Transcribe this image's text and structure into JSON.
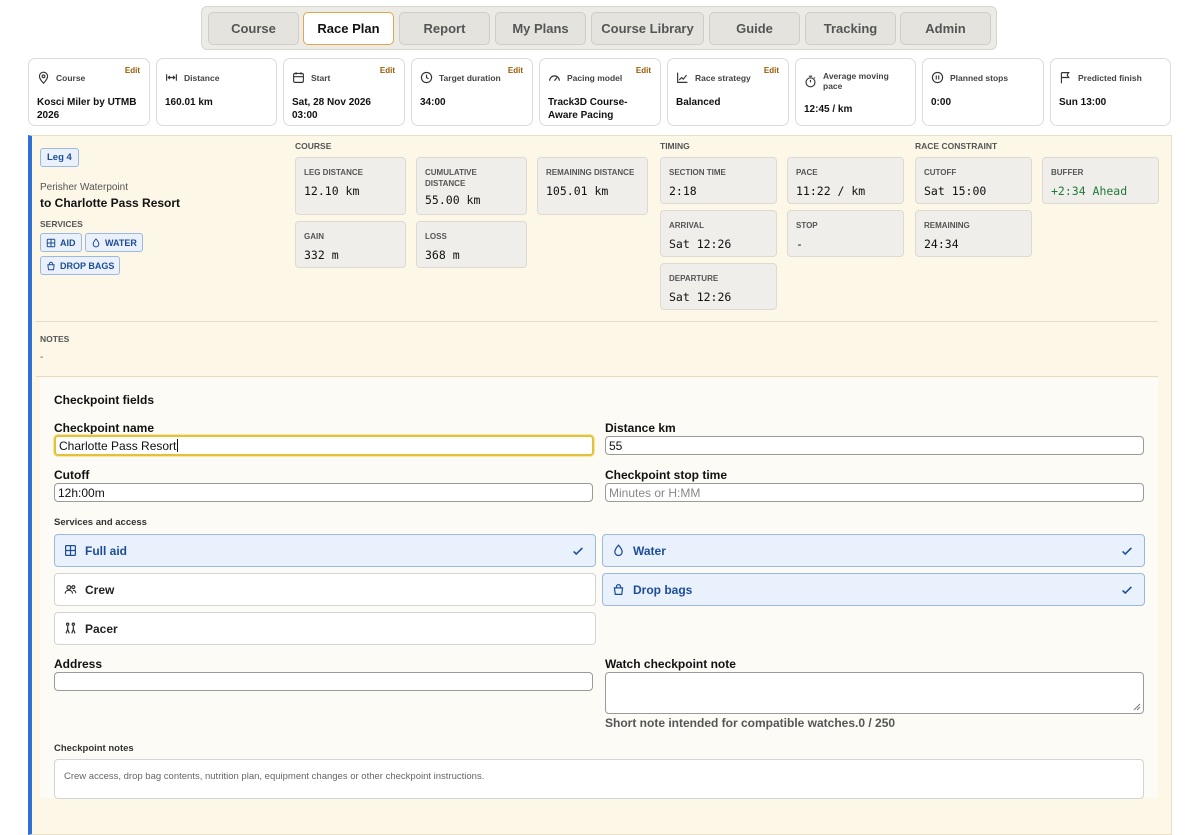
{
  "tabs": [
    "Course",
    "Race Plan",
    "Report",
    "My Plans",
    "Course Library",
    "Guide",
    "Tracking",
    "Admin"
  ],
  "active_tab": "Race Plan",
  "summary": {
    "edit_label": "Edit",
    "course": {
      "label": "Course",
      "value": "Kosci Miler by UTMB 2026"
    },
    "distance": {
      "label": "Distance",
      "value": "160.01 km"
    },
    "start": {
      "label": "Start",
      "value": "Sat, 28 Nov 2026 03:00"
    },
    "target_duration": {
      "label": "Target duration",
      "value": "34:00"
    },
    "pacing_model": {
      "label": "Pacing model",
      "value": "Track3D Course-Aware Pacing"
    },
    "race_strategy": {
      "label": "Race strategy",
      "value": "Balanced"
    },
    "avg_pace": {
      "label": "Average moving pace",
      "value": "12:45 / km"
    },
    "planned_stops": {
      "label": "Planned stops",
      "value": "0:00"
    },
    "predicted_finish": {
      "label": "Predicted finish",
      "value": "Sun 13:00"
    }
  },
  "leg": {
    "badge": "Leg 4",
    "from": "Perisher Waterpoint",
    "to": "to Charlotte Pass Resort",
    "services_label": "SERVICES",
    "services": {
      "aid": "AID",
      "water": "WATER",
      "drop_bags": "DROP BAGS"
    },
    "course_header": "COURSE",
    "timing_header": "TIMING",
    "constraint_header": "RACE CONSTRAINT",
    "stats": {
      "leg_distance": {
        "label": "LEG DISTANCE",
        "value": "12.10 km"
      },
      "cumulative_distance": {
        "label": "CUMULATIVE DISTANCE",
        "value": "55.00 km"
      },
      "remaining_distance": {
        "label": "REMAINING DISTANCE",
        "value": "105.01 km"
      },
      "gain": {
        "label": "GAIN",
        "value": "332 m"
      },
      "loss": {
        "label": "LOSS",
        "value": "368 m"
      },
      "section_time": {
        "label": "SECTION TIME",
        "value": "2:18"
      },
      "pace": {
        "label": "PACE",
        "value": "11:22 / km"
      },
      "arrival": {
        "label": "ARRIVAL",
        "value": "Sat 12:26"
      },
      "stop": {
        "label": "STOP",
        "value": "-"
      },
      "departure": {
        "label": "DEPARTURE",
        "value": "Sat 12:26"
      },
      "cutoff": {
        "label": "CUTOFF",
        "value": "Sat 15:00"
      },
      "remaining": {
        "label": "REMAINING",
        "value": "24:34"
      },
      "buffer": {
        "label": "BUFFER",
        "value": "+2:34 Ahead"
      }
    },
    "notes_label": "NOTES",
    "notes_value": "-"
  },
  "form": {
    "title": "Checkpoint fields",
    "name_label": "Checkpoint name",
    "name_value": "Charlotte Pass Resort",
    "distance_label": "Distance km",
    "distance_value": "55",
    "cutoff_label": "Cutoff",
    "cutoff_value": "12h:00m",
    "stop_time_label": "Checkpoint stop time",
    "stop_time_placeholder": "Minutes or H:MM",
    "services_header": "Services and access",
    "options": {
      "full_aid": "Full aid",
      "water": "Water",
      "crew": "Crew",
      "drop_bags": "Drop bags",
      "pacer": "Pacer"
    },
    "address_label": "Address",
    "address_value": "",
    "watch_note_label": "Watch checkpoint note",
    "watch_note_hint": "Short note intended for compatible watches.0 / 250",
    "checkpoint_notes_label": "Checkpoint notes",
    "checkpoint_notes_placeholder": "Crew access, drop bag contents, nutrition plan, equipment changes or other checkpoint instructions."
  },
  "colors": {
    "accent": "#2f6fd6",
    "edit": "#9a5a00",
    "ahead": "#1f7a3a",
    "focus": "#e3c23a"
  }
}
